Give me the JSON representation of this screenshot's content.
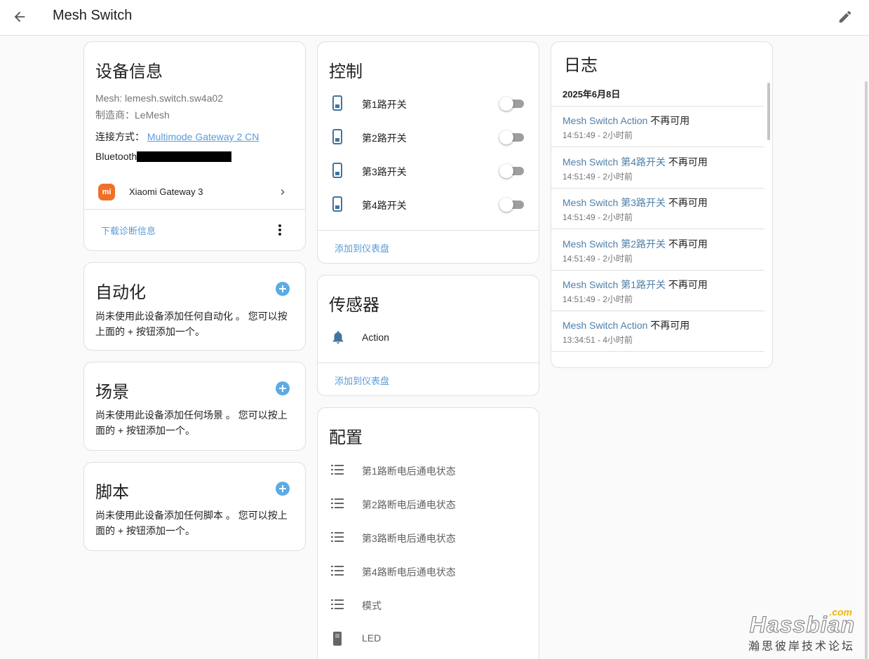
{
  "header": {
    "title": "Mesh Switch"
  },
  "device_info": {
    "title": "设备信息",
    "model": "Mesh: lemesh.switch.sw4a02",
    "manufacturer": "制造商：LeMesh",
    "connection_label": "连接方式：",
    "connection_link": "Multimode Gateway 2 CN",
    "bluetooth_label": "Bluetooth",
    "via_device": "Xiaomi Gateway 3",
    "via_device_logo": "mi",
    "download_diag": "下载诊断信息"
  },
  "automation": {
    "title": "自动化",
    "text": "尚未使用此设备添加任何自动化 。 您可以按上面的 + 按钮添加一个。"
  },
  "scene": {
    "title": "场景",
    "text": "尚未使用此设备添加任何场景 。 您可以按上面的 + 按钮添加一个。"
  },
  "script": {
    "title": "脚本",
    "text": "尚未使用此设备添加任何脚本 。 您可以按上面的 + 按钮添加一个。"
  },
  "controls": {
    "title": "控制",
    "items": [
      {
        "label": "第1路开关",
        "icon": "switch-icon",
        "on": false
      },
      {
        "label": "第2路开关",
        "icon": "switch-icon",
        "on": false
      },
      {
        "label": "第3路开关",
        "icon": "switch-icon",
        "on": false
      },
      {
        "label": "第4路开关",
        "icon": "switch-icon",
        "on": false
      }
    ],
    "add_to_dashboard": "添加到仪表盘"
  },
  "sensors": {
    "title": "传感器",
    "items": [
      {
        "label": "Action",
        "icon": "bell-icon"
      }
    ],
    "add_to_dashboard": "添加到仪表盘"
  },
  "config": {
    "title": "配置",
    "items": [
      {
        "label": "第1路断电后通电状态",
        "icon": "list-icon"
      },
      {
        "label": "第2路断电后通电状态",
        "icon": "list-icon"
      },
      {
        "label": "第3路断电后通电状态",
        "icon": "list-icon"
      },
      {
        "label": "第4路断电后通电状态",
        "icon": "list-icon"
      },
      {
        "label": "模式",
        "icon": "list-icon"
      },
      {
        "label": "LED",
        "icon": "switch-icon"
      }
    ]
  },
  "logbook": {
    "title": "日志",
    "date": "2025年6月8日",
    "entries": [
      {
        "entity": "Mesh Switch Action",
        "state": " 不再可用",
        "time": "14:51:49 - 2小时前"
      },
      {
        "entity": "Mesh Switch 第4路开关",
        "state": " 不再可用",
        "time": "14:51:49 - 2小时前"
      },
      {
        "entity": "Mesh Switch 第3路开关",
        "state": " 不再可用",
        "time": "14:51:49 - 2小时前"
      },
      {
        "entity": "Mesh Switch 第2路开关",
        "state": " 不再可用",
        "time": "14:51:49 - 2小时前"
      },
      {
        "entity": "Mesh Switch 第1路开关",
        "state": " 不再可用",
        "time": "14:51:49 - 2小时前"
      },
      {
        "entity": "Mesh Switch Action",
        "state": " 不再可用",
        "time": "13:34:51 - 4小时前"
      }
    ]
  },
  "watermark": {
    "com": ".com",
    "main": "Hassbian",
    "sub": "瀚思彼岸技术论坛"
  },
  "colors": {
    "accent": "#5aabe6",
    "link": "#5a9bd8",
    "mi_orange": "#f0702a",
    "icon": "#44739e"
  }
}
